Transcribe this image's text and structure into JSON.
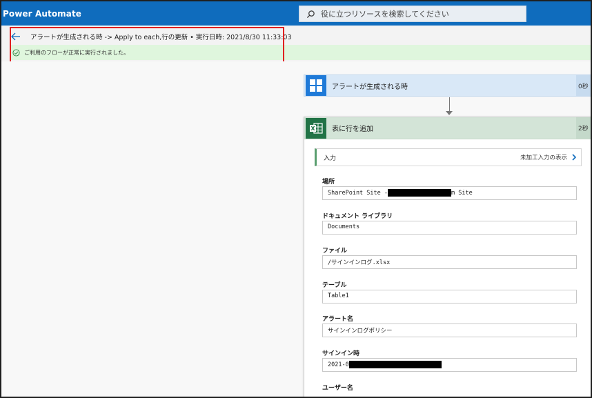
{
  "app": {
    "brand": "Power Automate",
    "search_placeholder": "役に立つリソースを検索してください"
  },
  "run_header": {
    "title": "アラートが生成される時 -> Apply to each,行の更新 • 実行日時: 2021/8/30 11:33:03",
    "status_message": "ご利用のフローが正常に実行されました。",
    "status_color": "#dff6dd",
    "highlight_color": "#e02020"
  },
  "flow": {
    "trigger": {
      "label": "アラートが生成される時",
      "duration": "0秒"
    },
    "action": {
      "title": "表に行を追加",
      "duration": "2秒",
      "inputs_label": "入力",
      "raw_inputs_link": "未加工入力の表示",
      "fields": [
        {
          "label": "場所",
          "value_prefix": "SharePoint Site -",
          "value_suffix": "m Site"
        },
        {
          "label": "ドキュメント ライブラリ",
          "value": "Documents"
        },
        {
          "label": "ファイル",
          "value": "/サインインログ.xlsx"
        },
        {
          "label": "テーブル",
          "value": "Table1"
        },
        {
          "label": "アラート名",
          "value": "サインインログポリシー"
        },
        {
          "label": "サインイン時",
          "value_prefix": "2021-0"
        },
        {
          "label": "ユーザー名"
        }
      ]
    }
  },
  "colors": {
    "topbar": "#0f6cbd",
    "trigger_accent": "#1f7ad8",
    "excel_accent": "#217346"
  }
}
